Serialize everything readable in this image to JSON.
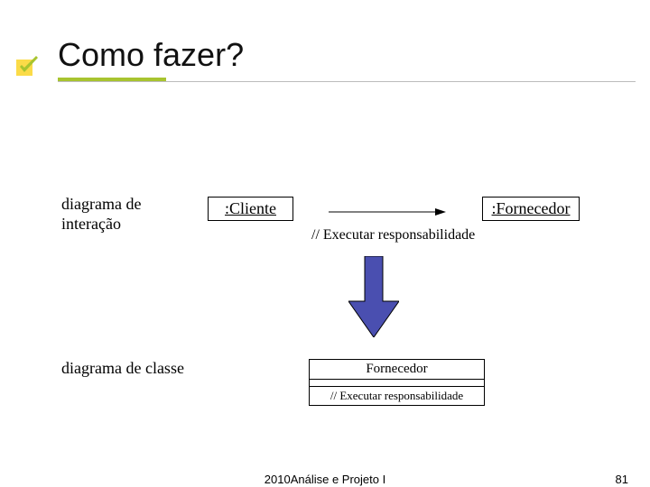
{
  "slide": {
    "title": "Como fazer?",
    "labels": {
      "interaction": "diagrama de interação",
      "class": "diagrama de classe"
    },
    "objects": {
      "cliente": ":Cliente",
      "fornecedor": ":Fornecedor"
    },
    "message": "// Executar responsabilidade",
    "class_box": {
      "name": "Fornecedor",
      "operation": "// Executar responsabilidade"
    },
    "footer": {
      "center": "2010Análise e Projeto I",
      "page": "81"
    }
  }
}
